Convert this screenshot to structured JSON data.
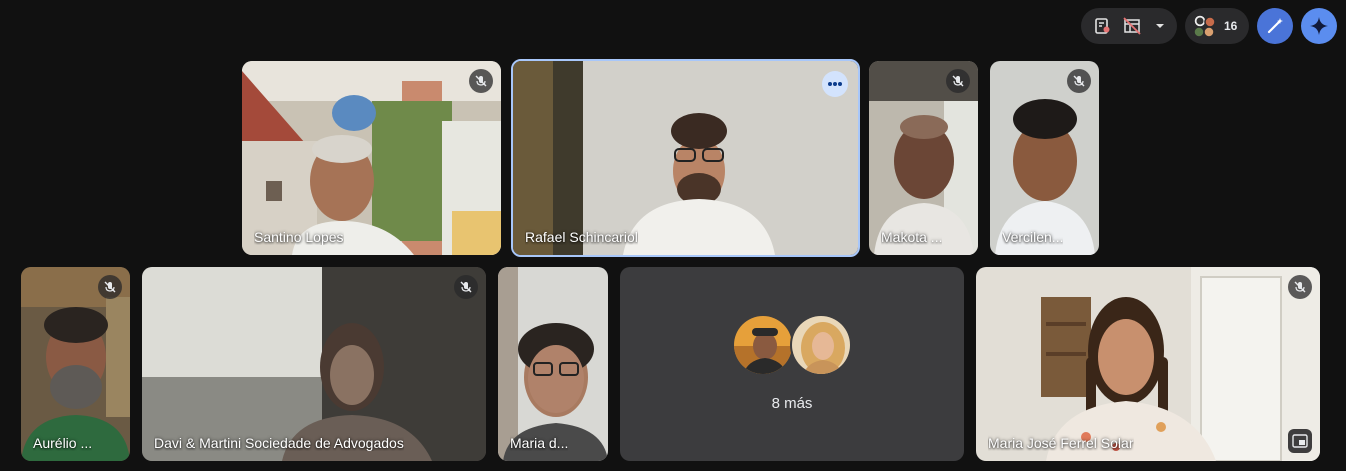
{
  "topbar": {
    "participant_count": "16",
    "icons": {
      "report": "report-icon",
      "layout": "layout-off-icon",
      "dropdown": "chevron-down-icon",
      "people": "people-avatars-icon",
      "effects": "magic-wand-icon",
      "gemini": "sparkle-icon"
    }
  },
  "colors": {
    "background": "#111111",
    "active_border": "#a8c7fa",
    "effects_button": "#4a74d8",
    "gemini_button": "#5b8def"
  },
  "participants": [
    {
      "name": "Santino Lopes",
      "muted": true
    },
    {
      "name": "Rafael Schincariol",
      "muted": false,
      "active": true
    },
    {
      "name": "Makota ...",
      "muted": true
    },
    {
      "name": "Vercilen...",
      "muted": true
    },
    {
      "name": "Aurélio ...",
      "muted": true
    },
    {
      "name": "Davi & Martini Sociedade de Advogados",
      "muted": true
    },
    {
      "name": "Maria d...",
      "muted": false
    },
    {
      "name": "Maria José Ferrel Solar",
      "muted": true
    }
  ],
  "others": {
    "label": "8 más"
  }
}
